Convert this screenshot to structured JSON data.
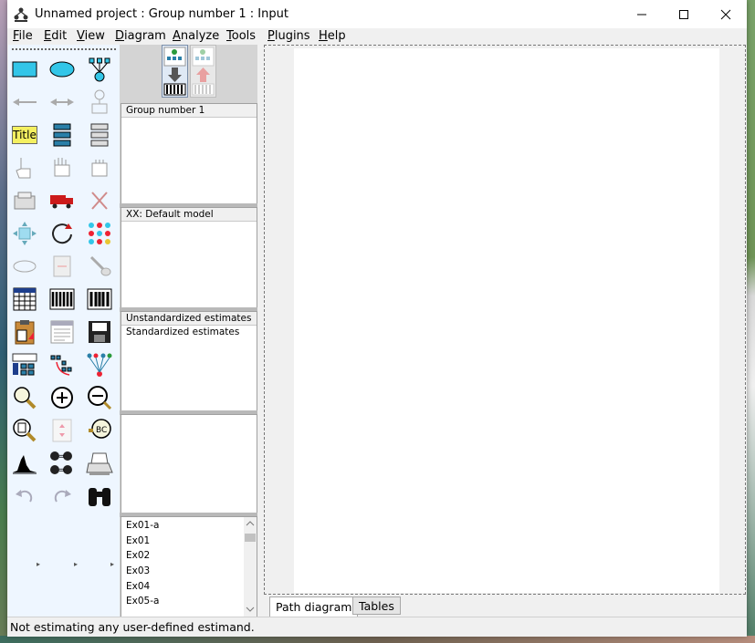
{
  "window": {
    "title": "Unnamed project : Group number 1 : Input"
  },
  "menu": {
    "file": {
      "u": "F",
      "rest": "ile"
    },
    "edit": {
      "u": "E",
      "rest": "dit"
    },
    "view": {
      "u": "V",
      "rest": "iew"
    },
    "diagram": {
      "u": "D",
      "rest": "iagram"
    },
    "analyze": {
      "u": "A",
      "rest": "nalyze"
    },
    "tools": {
      "u": "T",
      "rest": "ools"
    },
    "plugins": {
      "u": "P",
      "rest": "lugins"
    },
    "help": {
      "u": "H",
      "rest": "elp"
    }
  },
  "toolbox": {
    "title_icon_label": "Title"
  },
  "panels": {
    "groups_header": "Group number 1",
    "models_header": "XX: Default model",
    "estimates": [
      "Unstandardized estimates",
      "Standardized estimates"
    ]
  },
  "files": [
    "Ex01-a",
    "Ex01",
    "Ex02",
    "Ex03",
    "Ex04",
    "Ex05-a"
  ],
  "tabs": {
    "path_diagram": "Path diagram",
    "tables": "Tables"
  },
  "status": {
    "text": "Not estimating any user-defined estimand."
  },
  "colors": {
    "rect_fill": "#33c6e8",
    "title_bg": "#f4f060",
    "toolbox_bg": "#eef6ff"
  }
}
